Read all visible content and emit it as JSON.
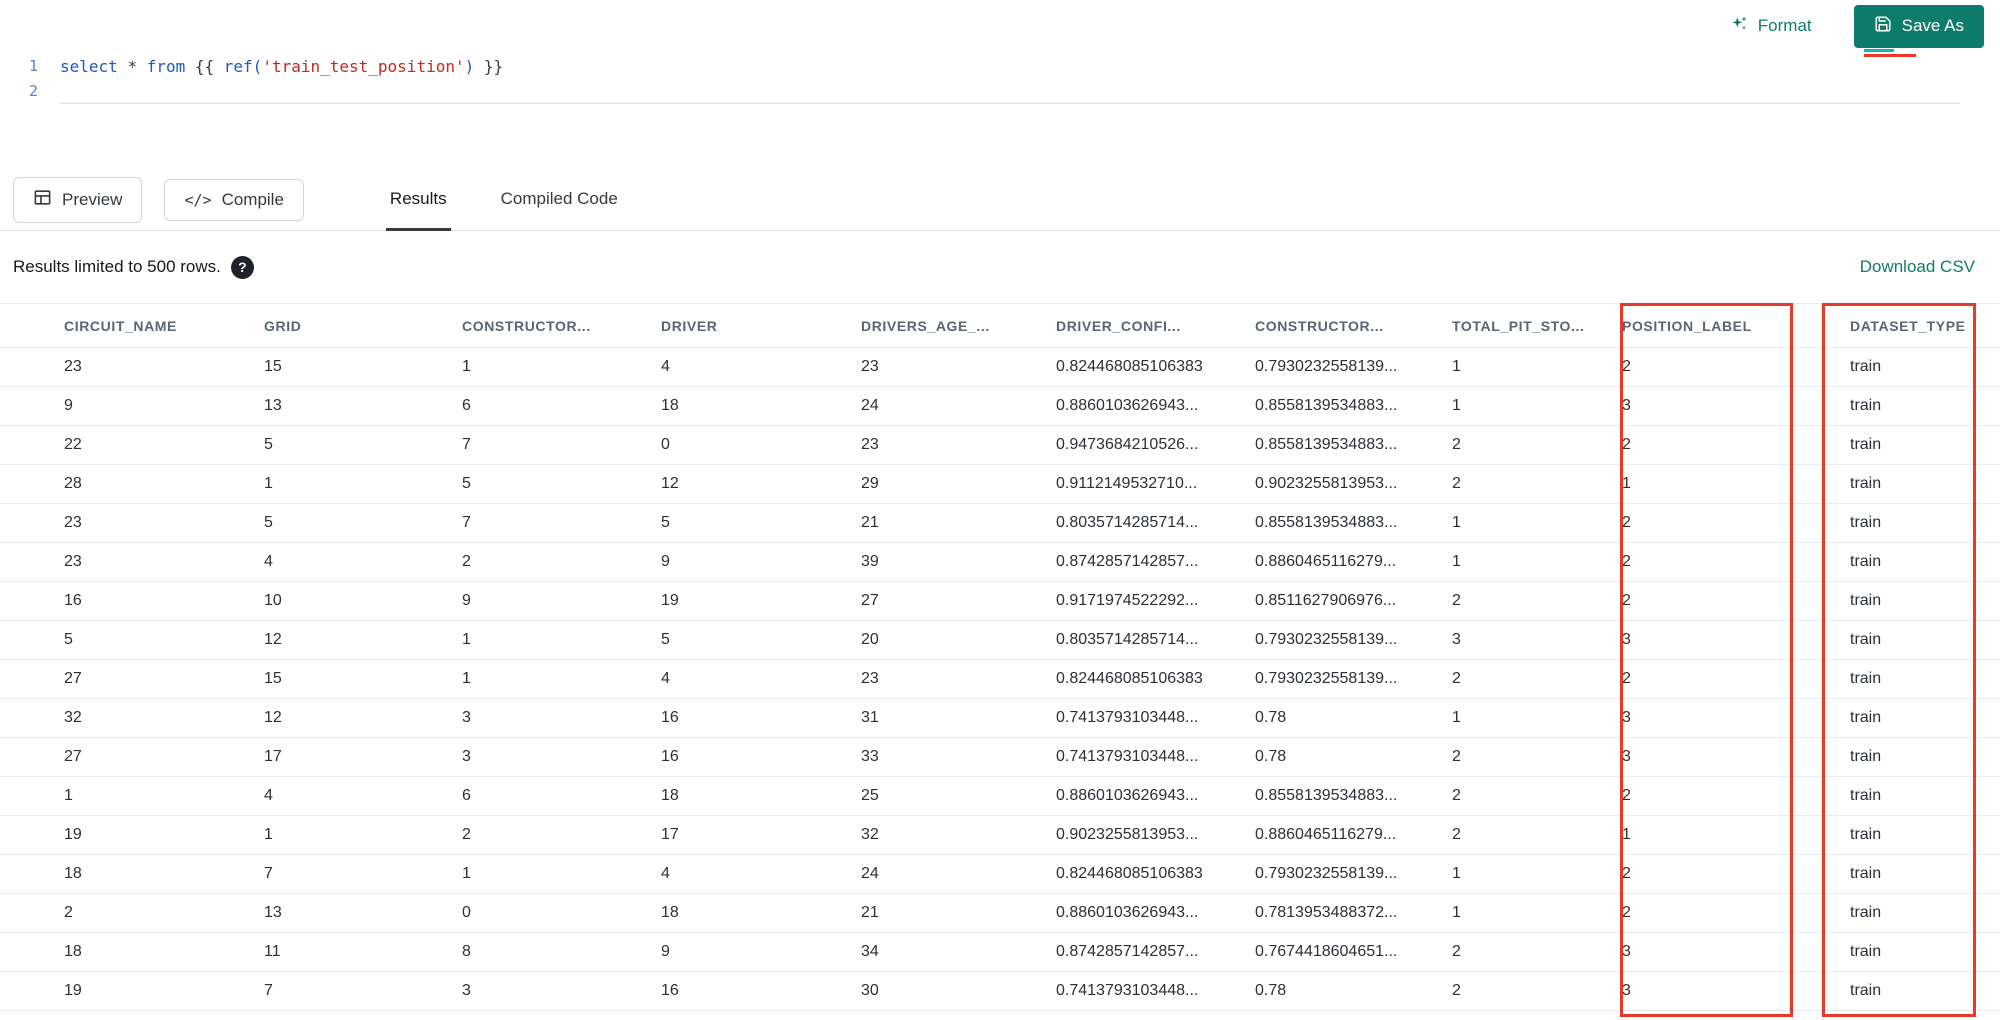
{
  "toolbar": {
    "format_label": "Format",
    "save_as_label": "Save As",
    "preview_label": "Preview",
    "compile_label": "Compile",
    "compile_icon": "</>"
  },
  "tabs": [
    {
      "label": "Results",
      "active": true
    },
    {
      "label": "Compiled Code",
      "active": false
    }
  ],
  "editor": {
    "lines": [
      {
        "number": "1",
        "tokens": [
          {
            "text": "select",
            "type": "keyword"
          },
          {
            "text": " ",
            "type": "plain"
          },
          {
            "text": "*",
            "type": "operator"
          },
          {
            "text": " ",
            "type": "plain"
          },
          {
            "text": "from",
            "type": "keyword"
          },
          {
            "text": " {{ ",
            "type": "brace"
          },
          {
            "text": "ref(",
            "type": "function"
          },
          {
            "text": "'train_test_position'",
            "type": "string"
          },
          {
            "text": ")",
            "type": "function"
          },
          {
            "text": " }}",
            "type": "brace"
          }
        ]
      },
      {
        "number": "2",
        "tokens": []
      }
    ]
  },
  "results": {
    "limit_text": "Results limited to 500 rows.",
    "help_icon": "?",
    "download_label": "Download CSV"
  },
  "colors": {
    "accent_teal": "#0e7c6b",
    "annotation_red": "#e8392a"
  },
  "table": {
    "columns": [
      "CIRCUIT_NAME",
      "GRID",
      "CONSTRUCTOR...",
      "DRIVER",
      "DRIVERS_AGE_...",
      "DRIVER_CONFI...",
      "CONSTRUCTOR...",
      "TOTAL_PIT_STO...",
      "POSITION_LABEL",
      "DATASET_TYPE"
    ],
    "rows": [
      [
        "23",
        "15",
        "1",
        "4",
        "23",
        "0.824468085106383",
        "0.7930232558139...",
        "1",
        "2",
        "train"
      ],
      [
        "9",
        "13",
        "6",
        "18",
        "24",
        "0.8860103626943...",
        "0.8558139534883...",
        "1",
        "3",
        "train"
      ],
      [
        "22",
        "5",
        "7",
        "0",
        "23",
        "0.9473684210526...",
        "0.8558139534883...",
        "2",
        "2",
        "train"
      ],
      [
        "28",
        "1",
        "5",
        "12",
        "29",
        "0.9112149532710...",
        "0.9023255813953...",
        "2",
        "1",
        "train"
      ],
      [
        "23",
        "5",
        "7",
        "5",
        "21",
        "0.8035714285714...",
        "0.8558139534883...",
        "1",
        "2",
        "train"
      ],
      [
        "23",
        "4",
        "2",
        "9",
        "39",
        "0.8742857142857...",
        "0.8860465116279...",
        "1",
        "2",
        "train"
      ],
      [
        "16",
        "10",
        "9",
        "19",
        "27",
        "0.9171974522292...",
        "0.8511627906976...",
        "2",
        "2",
        "train"
      ],
      [
        "5",
        "12",
        "1",
        "5",
        "20",
        "0.8035714285714...",
        "0.7930232558139...",
        "3",
        "3",
        "train"
      ],
      [
        "27",
        "15",
        "1",
        "4",
        "23",
        "0.824468085106383",
        "0.7930232558139...",
        "2",
        "2",
        "train"
      ],
      [
        "32",
        "12",
        "3",
        "16",
        "31",
        "0.7413793103448...",
        "0.78",
        "1",
        "3",
        "train"
      ],
      [
        "27",
        "17",
        "3",
        "16",
        "33",
        "0.7413793103448...",
        "0.78",
        "2",
        "3",
        "train"
      ],
      [
        "1",
        "4",
        "6",
        "18",
        "25",
        "0.8860103626943...",
        "0.8558139534883...",
        "2",
        "2",
        "train"
      ],
      [
        "19",
        "1",
        "2",
        "17",
        "32",
        "0.9023255813953...",
        "0.8860465116279...",
        "2",
        "1",
        "train"
      ],
      [
        "18",
        "7",
        "1",
        "4",
        "24",
        "0.824468085106383",
        "0.7930232558139...",
        "1",
        "2",
        "train"
      ],
      [
        "2",
        "13",
        "0",
        "18",
        "21",
        "0.8860103626943...",
        "0.7813953488372...",
        "1",
        "2",
        "train"
      ],
      [
        "18",
        "11",
        "8",
        "9",
        "34",
        "0.8742857142857...",
        "0.7674418604651...",
        "2",
        "3",
        "train"
      ],
      [
        "19",
        "7",
        "3",
        "16",
        "30",
        "0.7413793103448...",
        "0.78",
        "2",
        "3",
        "train"
      ]
    ]
  }
}
